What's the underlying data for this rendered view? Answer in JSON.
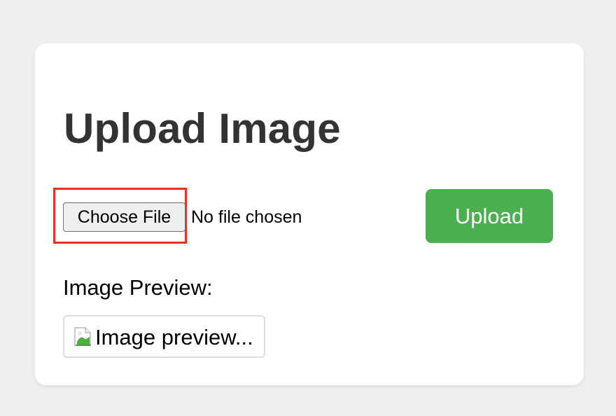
{
  "page": {
    "title": "Upload Image"
  },
  "file_picker": {
    "button_label": "Choose File",
    "status_text": "No file chosen"
  },
  "actions": {
    "upload_label": "Upload"
  },
  "preview": {
    "label": "Image Preview:",
    "alt_text": "Image preview..."
  },
  "colors": {
    "page_background": "#efefef",
    "card_background": "#ffffff",
    "title_text": "#333333",
    "upload_button": "#4caf50",
    "highlight_outline": "#e8321f"
  },
  "icons": {
    "preview_icon": "broken-image-icon"
  }
}
